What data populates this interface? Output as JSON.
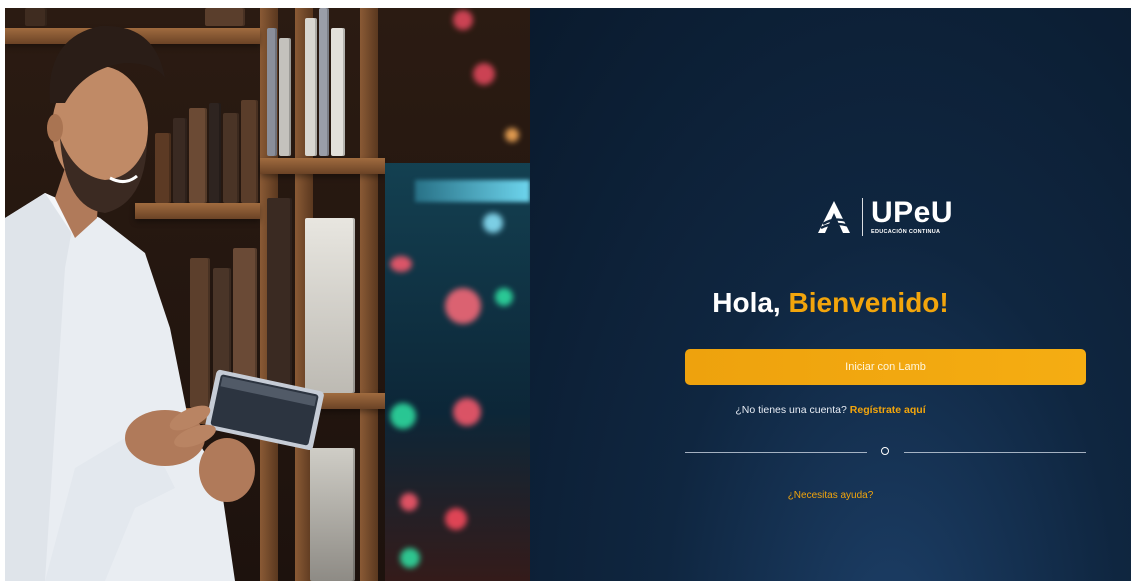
{
  "brand": {
    "name": "UPeU",
    "subtitle": "EDUCACIÓN CONTINUA"
  },
  "greeting": {
    "hello": "Hola,",
    "welcome": "Bienvenido!"
  },
  "actions": {
    "login_label": "Iniciar con Lamb",
    "signup_question": "¿No tienes una cuenta?",
    "signup_link": "Regístrate aquí",
    "help_link": "¿Necesitas ayuda?"
  },
  "colors": {
    "accent": "#f2a50c",
    "panel_bg": "#0f2640",
    "button_bg": "#eea20d"
  },
  "icons": {
    "logo": "upeu-logo-icon",
    "divider": "circle-icon"
  }
}
